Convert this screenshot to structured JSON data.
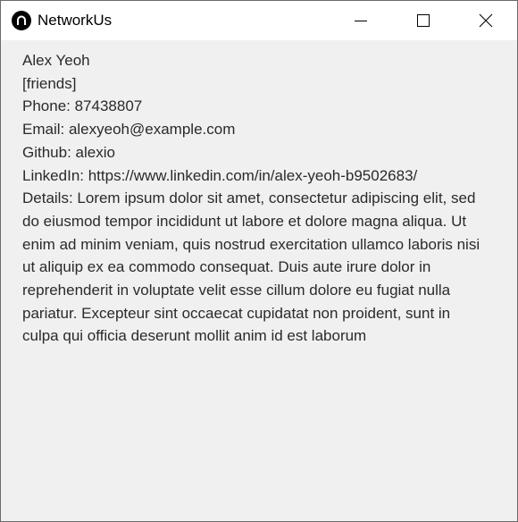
{
  "window": {
    "title": "NetworkUs",
    "icon": "app-logo-icon",
    "controls": [
      "minimize-icon",
      "maximize-icon",
      "close-icon"
    ]
  },
  "contact": {
    "name": "Alex Yeoh",
    "tags": "[friends]",
    "phone": "Phone: 87438807",
    "email": "Email: alexyeoh@example.com",
    "github": "Github: alexio",
    "linkedin": "LinkedIn: https://www.linkedin.com/in/alex-yeoh-b9502683/",
    "details_lines": [
      "Details: Lorem ipsum dolor sit amet, consectetur adipiscing elit, sed",
      "do eiusmod tempor incididunt ut labore et dolore magna aliqua. Ut",
      "enim ad minim veniam, quis nostrud exercitation ullamco laboris nisi",
      "ut aliquip ex ea commodo consequat. Duis aute irure dolor in",
      "reprehenderit in voluptate velit esse cillum dolore eu fugiat nulla",
      "pariatur. Excepteur sint occaecat cupidatat non proident, sunt in",
      "culpa qui officia deserunt mollit anim id est laborum"
    ]
  }
}
